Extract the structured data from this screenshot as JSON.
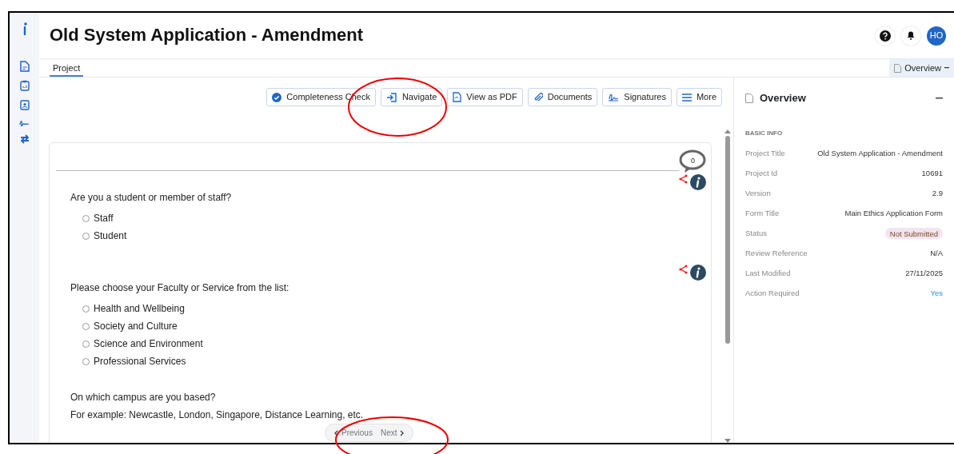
{
  "header": {
    "title": "Old System Application - Amendment",
    "avatar": "HO"
  },
  "tabs": [
    {
      "label": "Project",
      "selected": true
    }
  ],
  "panel_tab": {
    "label": "Overview"
  },
  "toolbar": [
    {
      "label": "Completeness Check"
    },
    {
      "label": "Navigate"
    },
    {
      "label": "View as PDF"
    },
    {
      "label": "Documents"
    },
    {
      "label": "Signatures"
    },
    {
      "label": "More"
    }
  ],
  "form": {
    "comment_count": "0",
    "questions": [
      {
        "text": "Are you a student or member of staff?",
        "options": [
          {
            "label": "Staff",
            "selected": false
          },
          {
            "label": "Student",
            "selected": false
          }
        ]
      },
      {
        "text": "Please choose your Faculty or Service from the list:",
        "options": [
          {
            "label": "Health and Wellbeing",
            "selected": false
          },
          {
            "label": "Society and Culture",
            "selected": false
          },
          {
            "label": "Science and Environment",
            "selected": false
          },
          {
            "label": "Professional Services",
            "selected": false
          }
        ]
      },
      {
        "text": "On which campus are you based?",
        "hint": "For example: Newcastle, London, Singapore, Distance Learning, etc."
      }
    ]
  },
  "pager": {
    "previous": "Previous",
    "next": "Next"
  },
  "overview": {
    "title": "Overview",
    "section": "BASIC INFO",
    "rows": [
      {
        "label": "Project Title",
        "value": "Old System Application - Amendment",
        "kind": "text"
      },
      {
        "label": "Project Id",
        "value": "10691",
        "kind": "text"
      },
      {
        "label": "Version",
        "value": "2.9",
        "kind": "text"
      },
      {
        "label": "Form Title",
        "value": "Main Ethics Application Form",
        "kind": "text"
      },
      {
        "label": "Status",
        "value": "Not Submitted",
        "kind": "badge"
      },
      {
        "label": "Review Reference",
        "value": "N/A",
        "kind": "text"
      },
      {
        "label": "Last Modified",
        "value": "27/11/2025",
        "kind": "text"
      },
      {
        "label": "Action Required",
        "value": "Yes",
        "kind": "link"
      }
    ]
  }
}
